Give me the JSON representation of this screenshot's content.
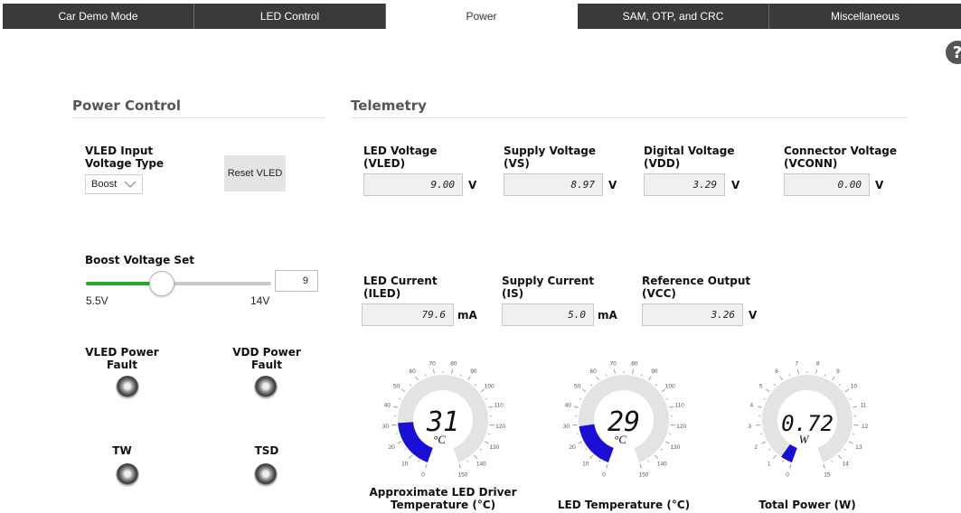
{
  "tabs": [
    {
      "label": "Car Demo Mode",
      "active": false
    },
    {
      "label": "LED Control",
      "active": false
    },
    {
      "label": "Power",
      "active": true
    },
    {
      "label": "SAM, OTP, and CRC",
      "active": false
    },
    {
      "label": "Miscellaneous",
      "active": false
    }
  ],
  "help": {
    "glyph": "?"
  },
  "power_control": {
    "title": "Power Control",
    "input_type_label_1": "VLED Input",
    "input_type_label_2": "Voltage Type",
    "input_type_value": "Boost",
    "reset_button": "Reset VLED",
    "boost_label": "Boost Voltage Set",
    "boost_min_label": "5.5V",
    "boost_max_label": "14V",
    "boost_value": "9",
    "boost_fraction": 0.41,
    "faults": {
      "vled_1": "VLED Power",
      "vled_2": "Fault",
      "vdd_1": "VDD Power",
      "vdd_2": "Fault",
      "tw": "TW",
      "tsd": "TSD"
    }
  },
  "telemetry": {
    "title": "Telemetry",
    "row1": [
      {
        "label1": "LED Voltage",
        "label2": "(VLED)",
        "value": "9.00",
        "unit": "V"
      },
      {
        "label1": "Supply Voltage",
        "label2": "(VS)",
        "value": "8.97",
        "unit": "V"
      },
      {
        "label1": "Digital Voltage",
        "label2": "(VDD)",
        "value": "3.29",
        "unit": "V"
      },
      {
        "label1": "Connector Voltage",
        "label2": "(VCONN)",
        "value": "0.00",
        "unit": "V"
      }
    ],
    "row2": [
      {
        "label1": "LED Current",
        "label2": "(ILED)",
        "value": "79.6",
        "unit": "mA"
      },
      {
        "label1": "Supply Current",
        "label2": "(IS)",
        "value": "5.0",
        "unit": "mA"
      },
      {
        "label1": "Reference Output",
        "label2": "(VCC)",
        "value": "3.26",
        "unit": "V"
      }
    ]
  },
  "gauges": [
    {
      "caption1": "Approximate LED Driver",
      "caption2": "Temperature (°C)",
      "value": 31,
      "display": "31",
      "unit": "°C",
      "min": 0,
      "max": 150,
      "ticks": [
        "0",
        "10",
        "20",
        "30",
        "40",
        "50",
        "60",
        "70",
        "80",
        "90",
        "100",
        "110",
        "120",
        "130",
        "140",
        "150"
      ]
    },
    {
      "caption1": "LED Temperature (°C)",
      "caption2": "",
      "value": 29,
      "display": "29",
      "unit": "°C",
      "min": 0,
      "max": 150,
      "ticks": [
        "0",
        "10",
        "20",
        "30",
        "40",
        "50",
        "60",
        "70",
        "80",
        "90",
        "100",
        "110",
        "120",
        "130",
        "140",
        "150"
      ]
    },
    {
      "caption1": "Total Power (W)",
      "caption2": "",
      "value": 0.72,
      "display": "0.72",
      "unit": "W",
      "min": 0,
      "max": 15,
      "ticks": [
        "0",
        "1",
        "2",
        "3",
        "4",
        "5",
        "6",
        "7",
        "8",
        "9",
        "10",
        "11",
        "12",
        "13",
        "14",
        "15"
      ]
    }
  ],
  "colors": {
    "gauge_fill": "#1a0fd6",
    "gauge_track": "#e3e3e3",
    "slider_fill": "#2ea52e"
  }
}
